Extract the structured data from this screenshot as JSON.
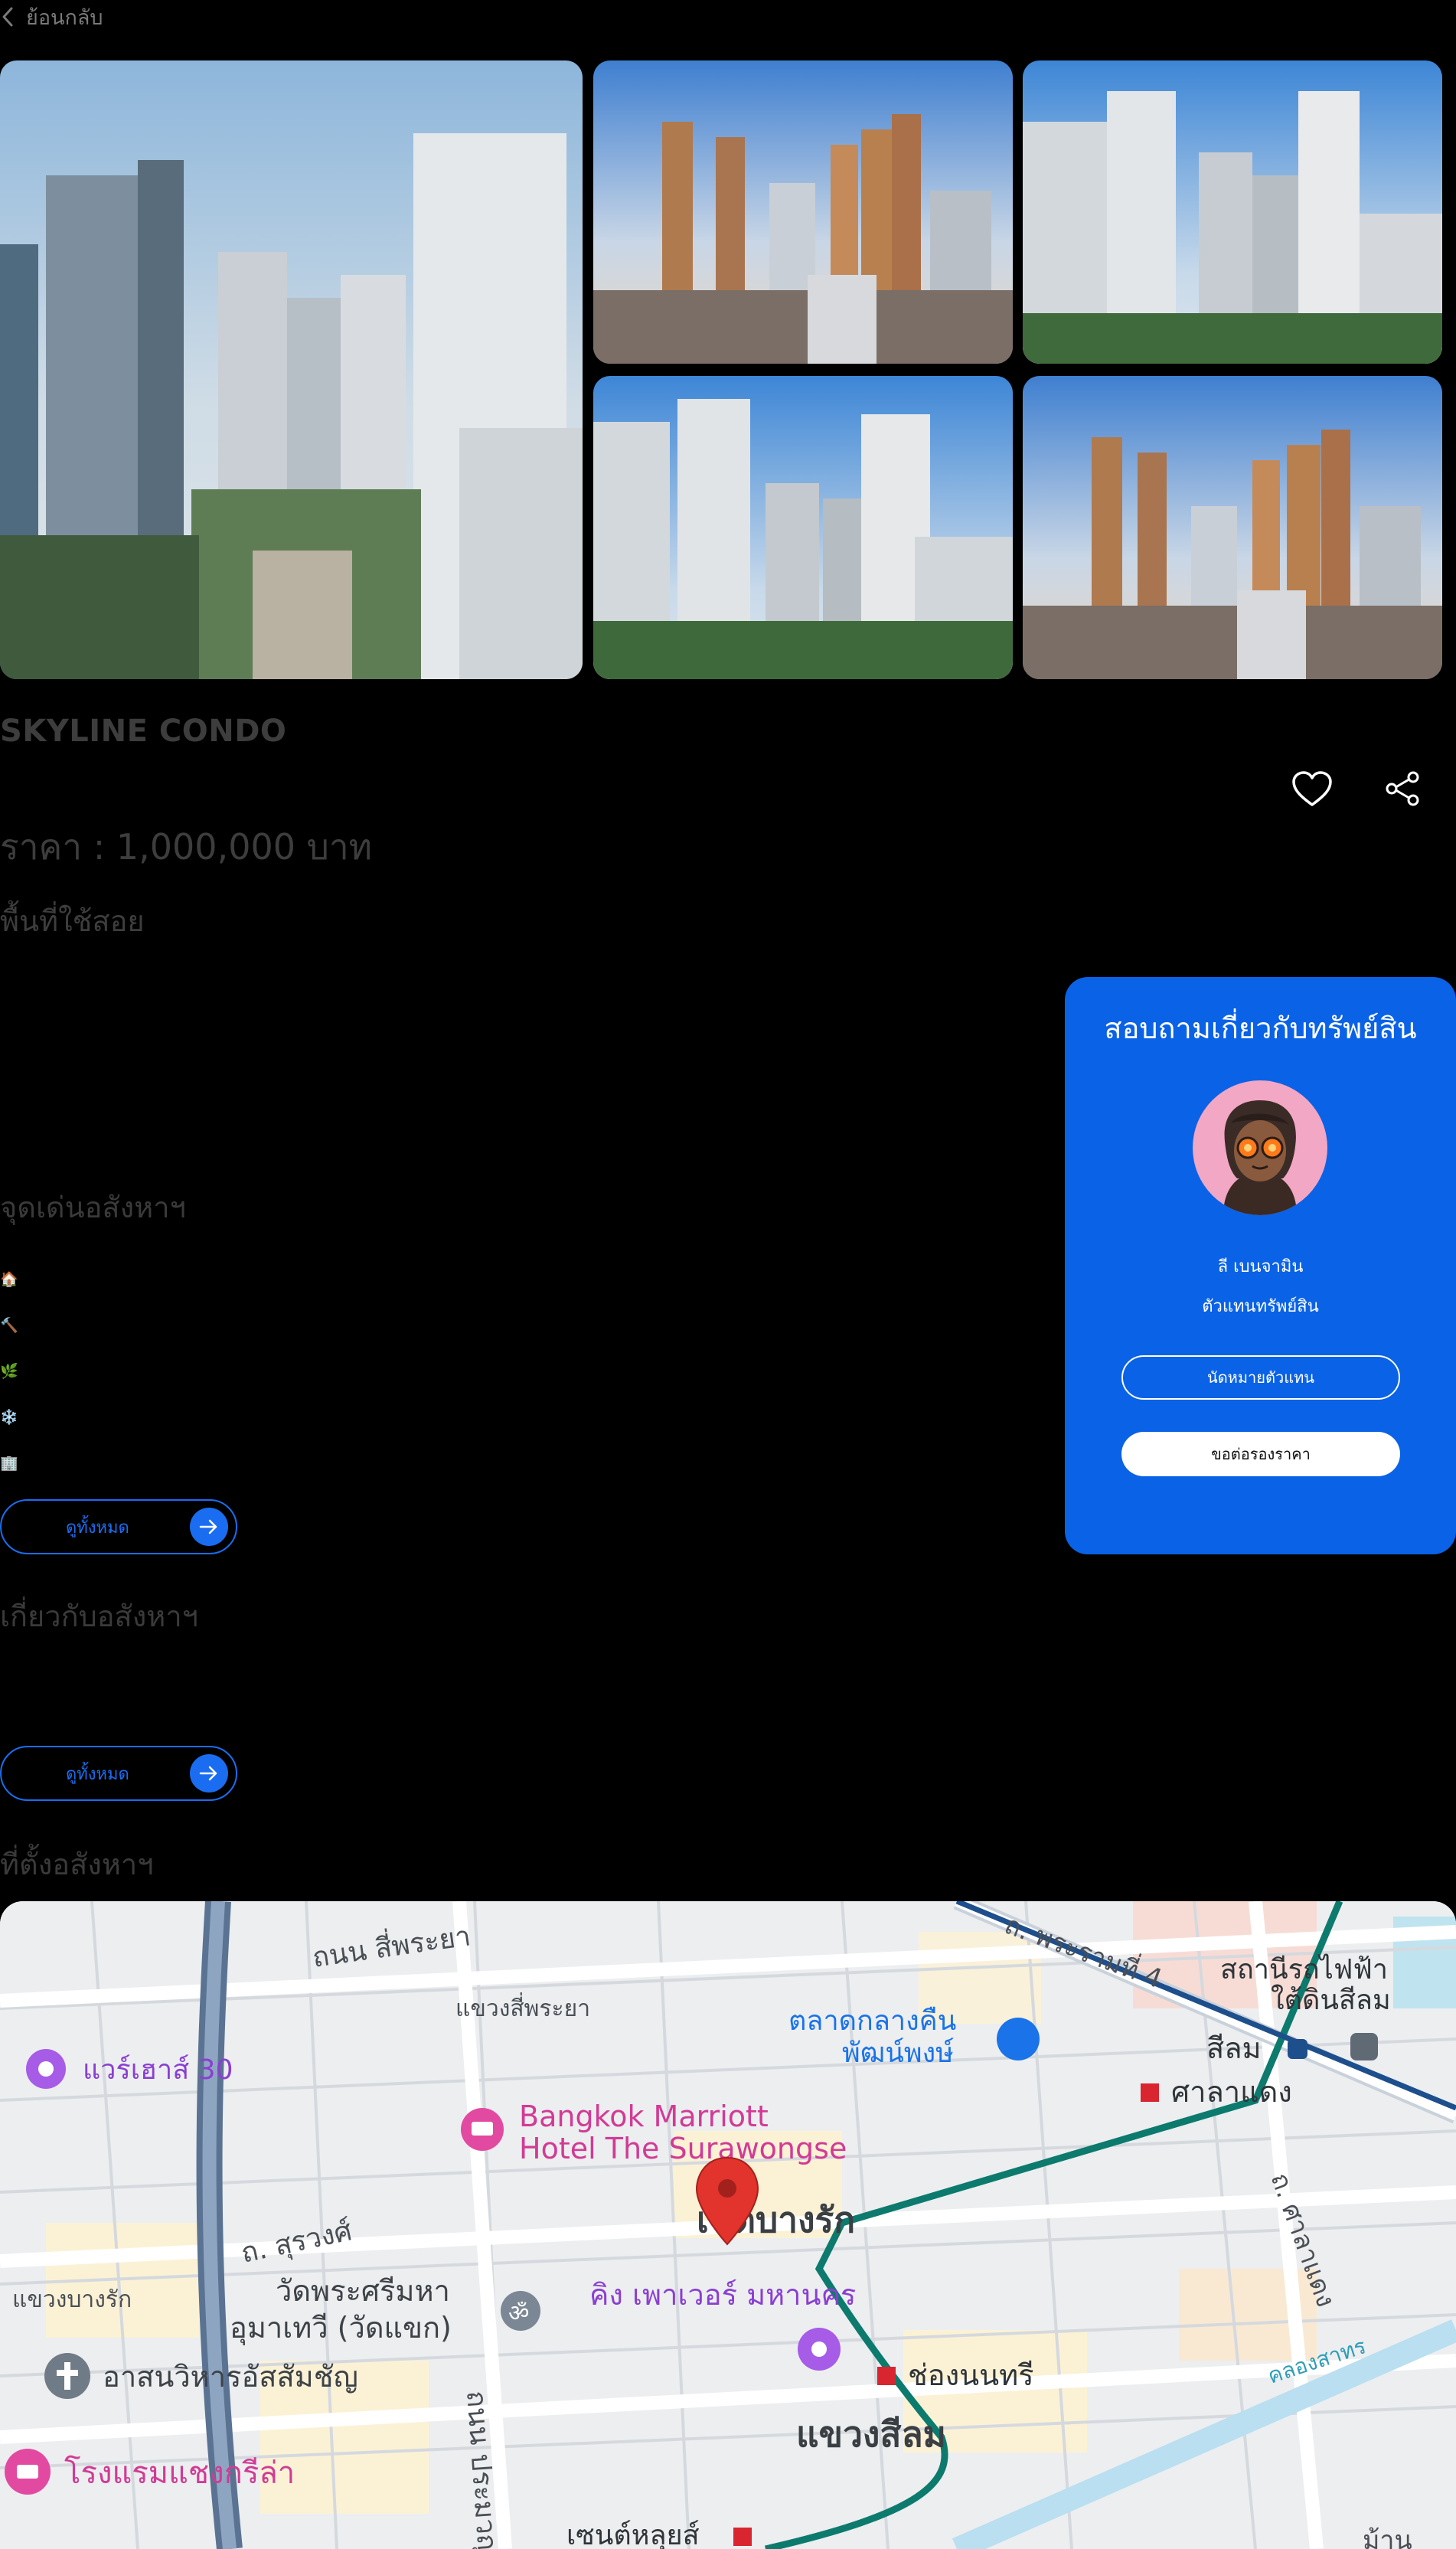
{
  "nav": {
    "back_label": "ย้อนกลับ"
  },
  "listing": {
    "title": "SKYLINE CONDO",
    "price": "ราคา : 1,000,000 บาท",
    "area_label": "พื้นที่ใช้สอย"
  },
  "highlights": {
    "heading": "จุดเด่นอสังหาฯ",
    "icons": [
      "🏠",
      "🔨",
      "🌿",
      "❄️",
      "🏢"
    ],
    "see_all": "ดูทั้งหมด"
  },
  "about": {
    "heading": "เกี่ยวกับอสังหาฯ",
    "see_all": "ดูทั้งหมด"
  },
  "location": {
    "heading": "ที่ตั้งอสังหาฯ"
  },
  "contact_card": {
    "title": "สอบถามเกี่ยวกับทรัพย์สิน",
    "agent_name": "ลี เบนจามิน",
    "agent_role": "ตัวแทนทรัพย์สิน",
    "appointment_button": "นัดหมายตัวแทน",
    "negotiate_button": "ขอต่อรองราคา",
    "accent_color": "#0a62e6"
  },
  "map": {
    "labels": {
      "road_siphraya": "ถนน สี่พระยา",
      "khwaeng_siphraya": "แขวงสี่พระยา",
      "rama4": "ถ. พระรามที่ 4",
      "station_title_1": "สถานีรถไฟฟ้า",
      "station_title_2": "ใต้ดินสีลม",
      "market_1": "ตลาดกลางคืน",
      "market_2": "พัฒน์พงษ์",
      "silom_station": "สีลม",
      "sala_daeng_station": "ศาลาแดง",
      "warehouse30": "แวร์เฮาส์ 30",
      "marriott_1": "Bangkok Marriott",
      "marriott_2": "Hotel The Surawongse",
      "road_surawong": "ถ. สุรวงศ์",
      "district_bangrak": "เขตบางรัก",
      "road_saladaeng": "ถ. ศาลาแดง",
      "khwaeng_bangrak": "แขวงบางรัก",
      "temple_1": "วัดพระศรีมหา",
      "temple_2": "อุมาเทวี (วัดแขก)",
      "king_power": "คิง เพาเวอร์ มหานคร",
      "cathedral": "อาสนวิหารอัสสัมชัญ",
      "chong_nonsi": "ช่องนนทรี",
      "khwaeng_silom": "แขวงสีลม",
      "shangri_la": "โรงแรมแชงกรีล่า",
      "canal": "คลองสาทร",
      "road_pramuan": "ถนน ประมวญ",
      "saint_louis": "เซนต์หลุยส์",
      "corner": "ม้าน"
    }
  }
}
